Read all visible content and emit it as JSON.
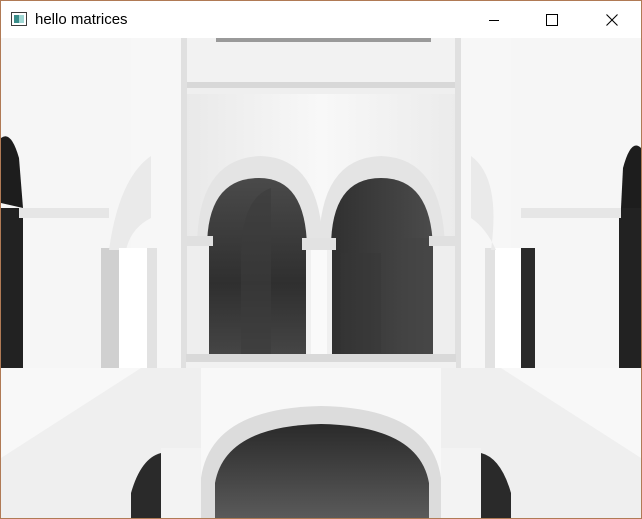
{
  "window": {
    "title": "hello matrices",
    "icon": "app-window-icon",
    "controls": {
      "minimize": "minimize-icon",
      "maximize": "maximize-icon",
      "close": "close-icon"
    }
  },
  "viewport": {
    "content": "rendered-3d-scene"
  },
  "colors": {
    "border": "#b07a55",
    "titlebar": "#ffffff",
    "scene_light": "#f4f4f4",
    "scene_dark": "#222222"
  }
}
